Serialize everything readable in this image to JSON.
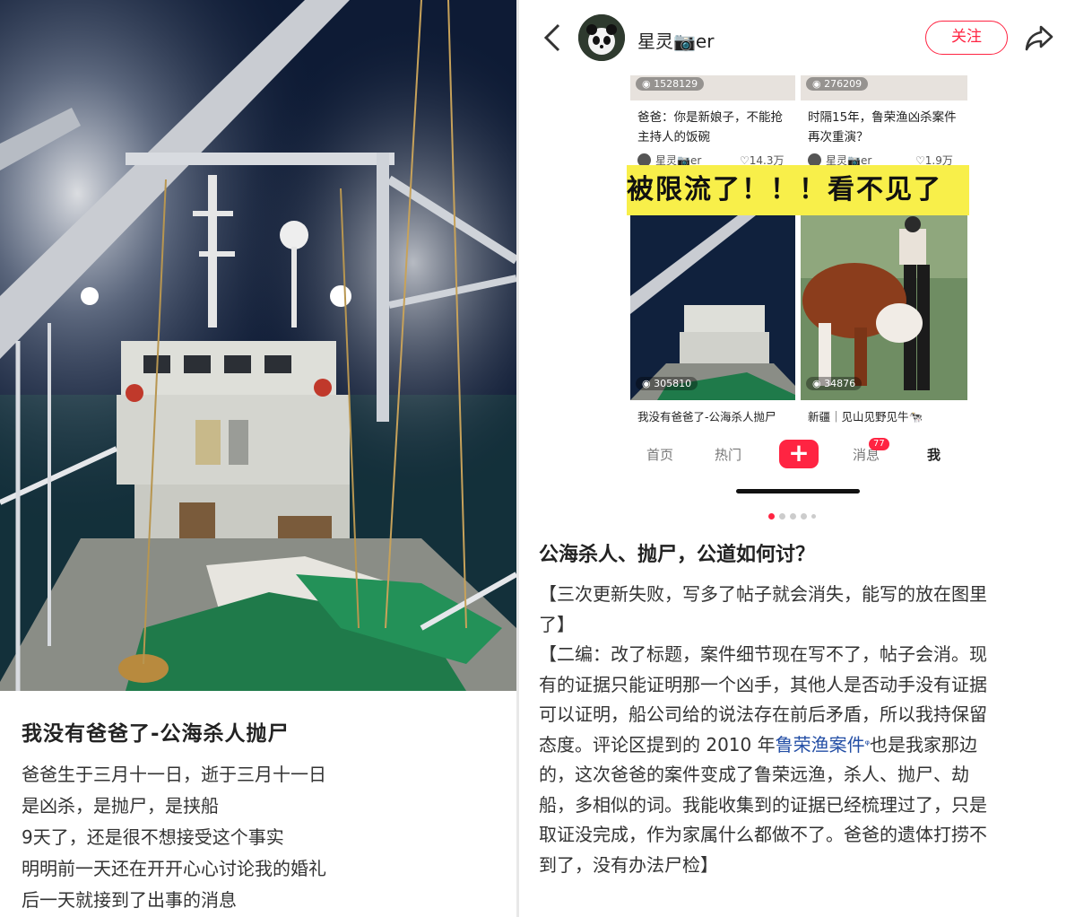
{
  "left_post": {
    "title": "我没有爸爸了-公海杀人抛尸",
    "body_lines": [
      "爸爸生于三月十一日，逝于三月十一日",
      "是凶杀，是抛尸，是挟船",
      "9天了，还是很不想接受这个事实",
      "明明前一天还在开开心心讨论我的婚礼",
      "后一天就接到了出事的消息"
    ]
  },
  "header": {
    "back_icon": "chevron-left-icon",
    "username": "星灵📷er",
    "follow_label": "关注",
    "share_icon": "share-icon"
  },
  "embedded_feed": {
    "top_cards": [
      {
        "views": "1528129",
        "title_line1": "爸爸：你是新娘子，不能抢",
        "title_line2": "主持人的饭碗",
        "author": "星灵📷er",
        "likes": "♡14.3万"
      },
      {
        "views": "276209",
        "title_line1": "时隔15年，鲁荣渔凶杀案件",
        "title_line2": "再次重演？",
        "author": "星灵📷er",
        "likes": "♡1.9万"
      }
    ],
    "banner": "被限流了！！！看不见了",
    "bottom_cards": [
      {
        "views": "305810",
        "title": "我没有爸爸了-公海杀人抛尸"
      },
      {
        "views": "34876",
        "title": "新疆｜见山见野见牛🐄"
      }
    ],
    "tabs": {
      "home": "首页",
      "hot": "热门",
      "plus": "+",
      "messages": "消息",
      "message_badge": "77",
      "me": "我"
    }
  },
  "carousel": {
    "total": 5,
    "active_index": 0
  },
  "post": {
    "title": "公海杀人、抛尸，公道如何讨？",
    "line1": "【三次更新失败，写多了帖子就会消失，能写的放在图里",
    "line2": "了】",
    "line3": "【二编：改了标题，案件细节现在写不了，帖子会消。现",
    "line4": "有的证据只能证明那一个凶手，其他人是否动手没有证据",
    "line5": "可以证明，船公司给的说法存在前后矛盾，所以我持保留",
    "line6_pre": "态度。评论区提到的 2010 年",
    "line6_link": "鲁荣渔案件",
    "line6_search": "ᵠ",
    "line6_post": "也是我家那边",
    "line7": "的，这次爸爸的案件变成了鲁荣远渔，杀人、抛尸、劫",
    "line8": "船，多相似的词。我能收集到的证据已经梳理过了，只是",
    "line9": "取证没完成，作为家属什么都做不了。爸爸的遗体打捞不",
    "line10": "到了，没有办法尸检】"
  },
  "colors": {
    "accent": "#ff2442",
    "banner": "#f8ef4a",
    "link": "#234ea5"
  }
}
